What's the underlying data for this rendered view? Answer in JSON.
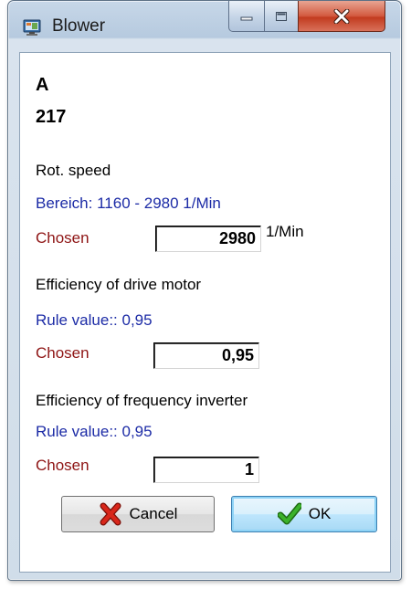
{
  "window": {
    "title": "Blower",
    "icon": "blower-app-icon",
    "caption_buttons": [
      "minimize-icon",
      "maximize-icon",
      "close-icon"
    ]
  },
  "header": {
    "line1": "A",
    "line2": "217"
  },
  "rot_speed": {
    "label": "Rot. speed",
    "range_text": "Bereich:  1160 -  2980 1/Min",
    "chosen_label": "Chosen",
    "chosen_value": "2980",
    "unit": "1/Min"
  },
  "drive_motor": {
    "label": "Efficiency of drive motor",
    "rule_text": "Rule value:: 0,95",
    "chosen_label": "Chosen",
    "chosen_value": "0,95"
  },
  "freq_inverter": {
    "label": "Efficiency of frequency inverter",
    "rule_text": "Rule value:: 0,95",
    "chosen_label": "Chosen",
    "chosen_value": "1"
  },
  "buttons": {
    "cancel": "Cancel",
    "ok": "OK"
  },
  "colors": {
    "info_blue": "#1c2ba6",
    "chosen_red": "#8e1414",
    "cancel_icon": "#cc1f10",
    "ok_icon": "#2f9a1e"
  }
}
